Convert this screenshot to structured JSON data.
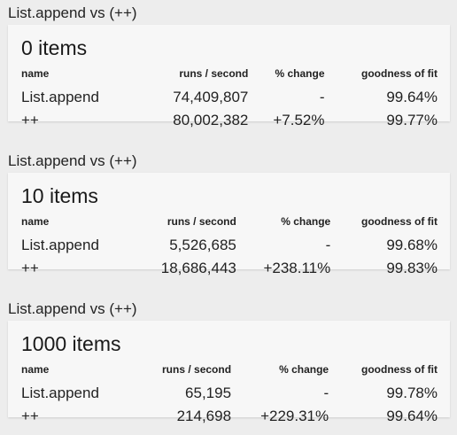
{
  "columns": [
    "name",
    "runs / second",
    "% change",
    "goodness of fit"
  ],
  "groups": [
    {
      "title": "List.append vs (++)",
      "card_title": "0 items",
      "rows": [
        {
          "name": "List.append",
          "runs": "74,409,807",
          "change": "-",
          "fit": "99.64%"
        },
        {
          "name": "++",
          "runs": "80,002,382",
          "change": "+7.52%",
          "fit": "99.77%"
        }
      ]
    },
    {
      "title": "List.append vs (++)",
      "card_title": "10 items",
      "rows": [
        {
          "name": "List.append",
          "runs": "5,526,685",
          "change": "-",
          "fit": "99.68%"
        },
        {
          "name": "++",
          "runs": "18,686,443",
          "change": "+238.11%",
          "fit": "99.83%"
        }
      ]
    },
    {
      "title": "List.append vs (++)",
      "card_title": "1000 items",
      "rows": [
        {
          "name": "List.append",
          "runs": "65,195",
          "change": "-",
          "fit": "99.78%"
        },
        {
          "name": "++",
          "runs": "214,698",
          "change": "+229.31%",
          "fit": "99.64%"
        }
      ]
    }
  ]
}
